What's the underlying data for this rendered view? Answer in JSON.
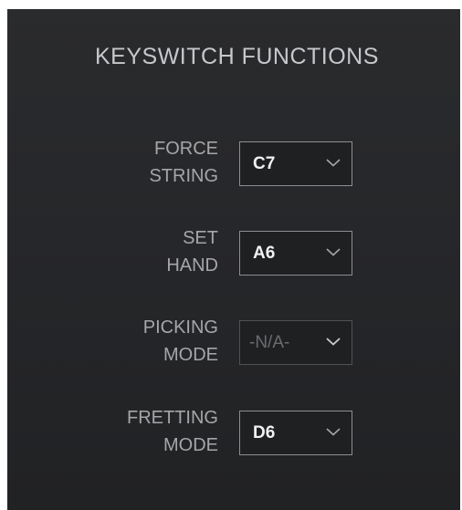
{
  "panel": {
    "title": "KEYSWITCH FUNCTIONS"
  },
  "rows": [
    {
      "label_line1": "FORCE",
      "label_line2": "STRING",
      "value": "C7",
      "enabled": true
    },
    {
      "label_line1": "SET",
      "label_line2": "HAND",
      "value": "A6",
      "enabled": true
    },
    {
      "label_line1": "PICKING",
      "label_line2": "MODE",
      "value": "-N/A-",
      "enabled": false
    },
    {
      "label_line1": "FRETTING",
      "label_line2": "MODE",
      "value": "D6",
      "enabled": true
    }
  ],
  "icons": {
    "dropdown": "chevron-down-icon"
  },
  "colors": {
    "background": "#26272a",
    "title": "#c6c8cb",
    "label": "#a4a6a9",
    "value": "#f1f2f3",
    "disabled": "#6a6c6f"
  }
}
